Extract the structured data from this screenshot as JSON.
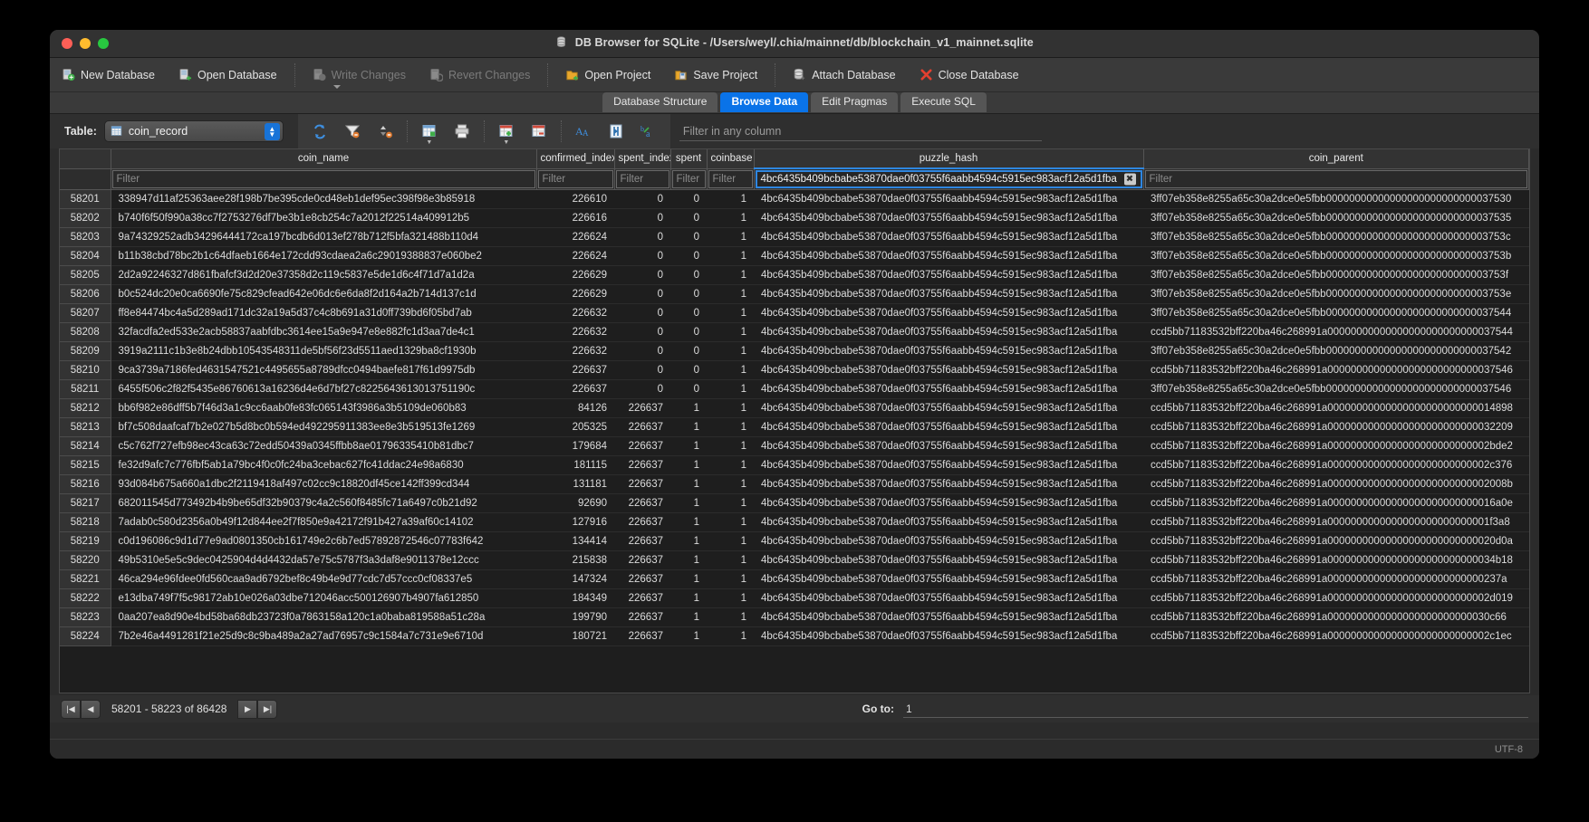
{
  "window": {
    "title": "DB Browser for SQLite - /Users/weyl/.chia/mainnet/db/blockchain_v1_mainnet.sqlite",
    "title_icon": "database-icon"
  },
  "toolbar": {
    "buttons": [
      {
        "label": "New Database",
        "icon": "new-database-icon",
        "disabled": false
      },
      {
        "label": "Open Database",
        "icon": "open-database-icon",
        "disabled": false
      },
      {
        "label": "Write Changes",
        "icon": "write-changes-icon",
        "disabled": true
      },
      {
        "label": "Revert Changes",
        "icon": "revert-changes-icon",
        "disabled": true
      },
      {
        "label": "Open Project",
        "icon": "open-project-icon",
        "disabled": false
      },
      {
        "label": "Save Project",
        "icon": "save-project-icon",
        "disabled": false
      },
      {
        "label": "Attach Database",
        "icon": "attach-database-icon",
        "disabled": false
      },
      {
        "label": "Close Database",
        "icon": "close-database-icon",
        "disabled": false
      }
    ]
  },
  "tabs": [
    {
      "label": "Database Structure",
      "active": false
    },
    {
      "label": "Browse Data",
      "active": true
    },
    {
      "label": "Edit Pragmas",
      "active": false
    },
    {
      "label": "Execute SQL",
      "active": false
    }
  ],
  "table_bar": {
    "label": "Table:",
    "selected_table": "coin_record",
    "filter_any_placeholder": "Filter in any column",
    "icons": [
      "refresh-icon",
      "clear-filters-icon",
      "clear-sorting-icon",
      "save-results-icon",
      "print-icon",
      "insert-record-icon",
      "delete-record-icon",
      "font-size-icon",
      "conditional-format-icon",
      "find-replace-icon"
    ]
  },
  "grid": {
    "columns": [
      {
        "key": "coin_name",
        "label": "coin_name"
      },
      {
        "key": "confirmed_index",
        "label": "confirmed_index"
      },
      {
        "key": "spent_index",
        "label": "spent_index"
      },
      {
        "key": "spent",
        "label": "spent"
      },
      {
        "key": "coinbase",
        "label": "coinbase"
      },
      {
        "key": "puzzle_hash",
        "label": "puzzle_hash"
      },
      {
        "key": "coin_parent",
        "label": "coin_parent"
      }
    ],
    "filter_placeholder": "Filter",
    "active_filter_column": "puzzle_hash",
    "active_filter_value": "4bc6435b409bcbabe53870dae0f03755f6aabb4594c5915ec983acf12a5d1fba",
    "clear_filter_glyph": "✖",
    "rows": [
      {
        "n": "58201",
        "coin_name": "338947d11af25363aee28f198b7be395cde0cd48eb1def95ec398f98e3b85918",
        "confirmed_index": "226610",
        "spent_index": "0",
        "spent": "0",
        "coinbase": "1",
        "puzzle_hash": "4bc6435b409bcbabe53870dae0f03755f6aabb4594c5915ec983acf12a5d1fba",
        "coin_parent": "3ff07eb358e8255a65c30a2dce0e5fbb00000000000000000000000000037530"
      },
      {
        "n": "58202",
        "coin_name": "b740f6f50f990a38cc7f2753276df7be3b1e8cb254c7a2012f22514a409912b5",
        "confirmed_index": "226616",
        "spent_index": "0",
        "spent": "0",
        "coinbase": "1",
        "puzzle_hash": "4bc6435b409bcbabe53870dae0f03755f6aabb4594c5915ec983acf12a5d1fba",
        "coin_parent": "3ff07eb358e8255a65c30a2dce0e5fbb00000000000000000000000000037535"
      },
      {
        "n": "58203",
        "coin_name": "9a74329252adb34296444172ca197bcdb6d013ef278b712f5bfa321488b110d4",
        "confirmed_index": "226624",
        "spent_index": "0",
        "spent": "0",
        "coinbase": "1",
        "puzzle_hash": "4bc6435b409bcbabe53870dae0f03755f6aabb4594c5915ec983acf12a5d1fba",
        "coin_parent": "3ff07eb358e8255a65c30a2dce0e5fbb0000000000000000000000000003753c"
      },
      {
        "n": "58204",
        "coin_name": "b11b38cbd78bc2b1c64dfaeb1664e172cdd93cdaea2a6c29019388837e060be2",
        "confirmed_index": "226624",
        "spent_index": "0",
        "spent": "0",
        "coinbase": "1",
        "puzzle_hash": "4bc6435b409bcbabe53870dae0f03755f6aabb4594c5915ec983acf12a5d1fba",
        "coin_parent": "3ff07eb358e8255a65c30a2dce0e5fbb0000000000000000000000000003753b"
      },
      {
        "n": "58205",
        "coin_name": "2d2a92246327d861fbafcf3d2d20e37358d2c119c5837e5de1d6c4f71d7a1d2a",
        "confirmed_index": "226629",
        "spent_index": "0",
        "spent": "0",
        "coinbase": "1",
        "puzzle_hash": "4bc6435b409bcbabe53870dae0f03755f6aabb4594c5915ec983acf12a5d1fba",
        "coin_parent": "3ff07eb358e8255a65c30a2dce0e5fbb0000000000000000000000000003753f"
      },
      {
        "n": "58206",
        "coin_name": "b0c524dc20e0ca6690fe75c829cfead642e06dc6e6da8f2d164a2b714d137c1d",
        "confirmed_index": "226629",
        "spent_index": "0",
        "spent": "0",
        "coinbase": "1",
        "puzzle_hash": "4bc6435b409bcbabe53870dae0f03755f6aabb4594c5915ec983acf12a5d1fba",
        "coin_parent": "3ff07eb358e8255a65c30a2dce0e5fbb0000000000000000000000000003753e"
      },
      {
        "n": "58207",
        "coin_name": "ff8e84474bc4a5d289ad171dc32a19a5d37c4c8b691a31d0ff739bd6f05bd7ab",
        "confirmed_index": "226632",
        "spent_index": "0",
        "spent": "0",
        "coinbase": "1",
        "puzzle_hash": "4bc6435b409bcbabe53870dae0f03755f6aabb4594c5915ec983acf12a5d1fba",
        "coin_parent": "3ff07eb358e8255a65c30a2dce0e5fbb00000000000000000000000000037544"
      },
      {
        "n": "58208",
        "coin_name": "32facdfa2ed533e2acb58837aabfdbc3614ee15a9e947e8e882fc1d3aa7de4c1",
        "confirmed_index": "226632",
        "spent_index": "0",
        "spent": "0",
        "coinbase": "1",
        "puzzle_hash": "4bc6435b409bcbabe53870dae0f03755f6aabb4594c5915ec983acf12a5d1fba",
        "coin_parent": "ccd5bb71183532bff220ba46c268991a00000000000000000000000000037544"
      },
      {
        "n": "58209",
        "coin_name": "3919a2111c1b3e8b24dbb10543548311de5bf56f23d5511aed1329ba8cf1930b",
        "confirmed_index": "226632",
        "spent_index": "0",
        "spent": "0",
        "coinbase": "1",
        "puzzle_hash": "4bc6435b409bcbabe53870dae0f03755f6aabb4594c5915ec983acf12a5d1fba",
        "coin_parent": "3ff07eb358e8255a65c30a2dce0e5fbb00000000000000000000000000037542"
      },
      {
        "n": "58210",
        "coin_name": "9ca3739a7186fed4631547521c4495655a8789dfcc0494baefe817f61d9975db",
        "confirmed_index": "226637",
        "spent_index": "0",
        "spent": "0",
        "coinbase": "1",
        "puzzle_hash": "4bc6435b409bcbabe53870dae0f03755f6aabb4594c5915ec983acf12a5d1fba",
        "coin_parent": "ccd5bb71183532bff220ba46c268991a00000000000000000000000000037546"
      },
      {
        "n": "58211",
        "coin_name": "6455f506c2f82f5435e86760613a16236d4e6d7bf27c8225643613013751190c",
        "confirmed_index": "226637",
        "spent_index": "0",
        "spent": "0",
        "coinbase": "1",
        "puzzle_hash": "4bc6435b409bcbabe53870dae0f03755f6aabb4594c5915ec983acf12a5d1fba",
        "coin_parent": "3ff07eb358e8255a65c30a2dce0e5fbb00000000000000000000000000037546"
      },
      {
        "n": "58212",
        "coin_name": "bb6f982e86dff5b7f46d3a1c9cc6aab0fe83fc065143f3986a3b5109de060b83",
        "confirmed_index": "84126",
        "spent_index": "226637",
        "spent": "1",
        "coinbase": "1",
        "puzzle_hash": "4bc6435b409bcbabe53870dae0f03755f6aabb4594c5915ec983acf12a5d1fba",
        "coin_parent": "ccd5bb71183532bff220ba46c268991a00000000000000000000000000014898"
      },
      {
        "n": "58213",
        "coin_name": "bf7c508daafcaf7b2e027b5d8bc0b594ed492295911383ee8e3b519513fe1269",
        "confirmed_index": "205325",
        "spent_index": "226637",
        "spent": "1",
        "coinbase": "1",
        "puzzle_hash": "4bc6435b409bcbabe53870dae0f03755f6aabb4594c5915ec983acf12a5d1fba",
        "coin_parent": "ccd5bb71183532bff220ba46c268991a00000000000000000000000000032209"
      },
      {
        "n": "58214",
        "coin_name": "c5c762f727efb98ec43ca63c72edd50439a0345ffbb8ae01796335410b81dbc7",
        "confirmed_index": "179684",
        "spent_index": "226637",
        "spent": "1",
        "coinbase": "1",
        "puzzle_hash": "4bc6435b409bcbabe53870dae0f03755f6aabb4594c5915ec983acf12a5d1fba",
        "coin_parent": "ccd5bb71183532bff220ba46c268991a0000000000000000000000000002bde2"
      },
      {
        "n": "58215",
        "coin_name": "fe32d9afc7c776fbf5ab1a79bc4f0c0fc24ba3cebac627fc41ddac24e98a6830",
        "confirmed_index": "181115",
        "spent_index": "226637",
        "spent": "1",
        "coinbase": "1",
        "puzzle_hash": "4bc6435b409bcbabe53870dae0f03755f6aabb4594c5915ec983acf12a5d1fba",
        "coin_parent": "ccd5bb71183532bff220ba46c268991a0000000000000000000000000002c376"
      },
      {
        "n": "58216",
        "coin_name": "93d084b675a660a1dbc2f2119418af497c02cc9c18820df45ce142ff399cd344",
        "confirmed_index": "131181",
        "spent_index": "226637",
        "spent": "1",
        "coinbase": "1",
        "puzzle_hash": "4bc6435b409bcbabe53870dae0f03755f6aabb4594c5915ec983acf12a5d1fba",
        "coin_parent": "ccd5bb71183532bff220ba46c268991a0000000000000000000000000002008b"
      },
      {
        "n": "58217",
        "coin_name": "682011545d773492b4b9be65df32b90379c4a2c560f8485fc71a6497c0b21d92",
        "confirmed_index": "92690",
        "spent_index": "226637",
        "spent": "1",
        "coinbase": "1",
        "puzzle_hash": "4bc6435b409bcbabe53870dae0f03755f6aabb4594c5915ec983acf12a5d1fba",
        "coin_parent": "ccd5bb71183532bff220ba46c268991a00000000000000000000000000016a0e"
      },
      {
        "n": "58218",
        "coin_name": "7adab0c580d2356a0b49f12d844ee2f7f850e9a42172f91b427a39af60c14102",
        "confirmed_index": "127916",
        "spent_index": "226637",
        "spent": "1",
        "coinbase": "1",
        "puzzle_hash": "4bc6435b409bcbabe53870dae0f03755f6aabb4594c5915ec983acf12a5d1fba",
        "coin_parent": "ccd5bb71183532bff220ba46c268991a0000000000000000000000000001f3a8"
      },
      {
        "n": "58219",
        "coin_name": "c0d196086c9d1d77e9ad0801350cb161749e2c6b7ed57892872546c07783f642",
        "confirmed_index": "134414",
        "spent_index": "226637",
        "spent": "1",
        "coinbase": "1",
        "puzzle_hash": "4bc6435b409bcbabe53870dae0f03755f6aabb4594c5915ec983acf12a5d1fba",
        "coin_parent": "ccd5bb71183532bff220ba46c268991a00000000000000000000000000020d0a"
      },
      {
        "n": "58220",
        "coin_name": "49b5310e5e5c9dec0425904d4d4432da57e75c5787f3a3daf8e9011378e12ccc",
        "confirmed_index": "215838",
        "spent_index": "226637",
        "spent": "1",
        "coinbase": "1",
        "puzzle_hash": "4bc6435b409bcbabe53870dae0f03755f6aabb4594c5915ec983acf12a5d1fba",
        "coin_parent": "ccd5bb71183532bff220ba46c268991a00000000000000000000000000034b18"
      },
      {
        "n": "58221",
        "coin_name": "46ca294e96fdee0fd560caa9ad6792bef8c49b4e9d77cdc7d57ccc0cf08337e5",
        "confirmed_index": "147324",
        "spent_index": "226637",
        "spent": "1",
        "coinbase": "1",
        "puzzle_hash": "4bc6435b409bcbabe53870dae0f03755f6aabb4594c5915ec983acf12a5d1fba",
        "coin_parent": "ccd5bb71183532bff220ba46c268991a000000000000000000000000000237a"
      },
      {
        "n": "58222",
        "coin_name": "e13dba749f7f5c98172ab10e026a03dbe712046acc500126907b4907fa612850",
        "confirmed_index": "184349",
        "spent_index": "226637",
        "spent": "1",
        "coinbase": "1",
        "puzzle_hash": "4bc6435b409bcbabe53870dae0f03755f6aabb4594c5915ec983acf12a5d1fba",
        "coin_parent": "ccd5bb71183532bff220ba46c268991a0000000000000000000000000002d019"
      },
      {
        "n": "58223",
        "coin_name": "0aa207ea8d90e4bd58ba68db23723f0a7863158a120c1a0baba819588a51c28a",
        "confirmed_index": "199790",
        "spent_index": "226637",
        "spent": "1",
        "coinbase": "1",
        "puzzle_hash": "4bc6435b409bcbabe53870dae0f03755f6aabb4594c5915ec983acf12a5d1fba",
        "coin_parent": "ccd5bb71183532bff220ba46c268991a0000000000000000000000000030c66"
      },
      {
        "n": "58224",
        "coin_name": "7b2e46a4491281f21e25d9c8c9ba489a2a27ad76957c9c1584a7c731e9e6710d",
        "confirmed_index": "180721",
        "spent_index": "226637",
        "spent": "1",
        "coinbase": "1",
        "puzzle_hash": "4bc6435b409bcbabe53870dae0f03755f6aabb4594c5915ec983acf12a5d1fba",
        "coin_parent": "ccd5bb71183532bff220ba46c268991a0000000000000000000000000002c1ec"
      }
    ]
  },
  "pager": {
    "first_glyph": "|◀",
    "prev_glyph": "◀",
    "next_glyph": "▶",
    "last_glyph": "▶|",
    "range_text": "58201 - 58223 of 86428",
    "goto_label": "Go to:",
    "goto_value": "1"
  },
  "status": {
    "encoding": "UTF-8"
  },
  "colors": {
    "accent": "#0a73e8",
    "window_bg": "#2b2b2b",
    "grid_bg": "#1e1e1e",
    "close_db_red": "#e4402f"
  }
}
